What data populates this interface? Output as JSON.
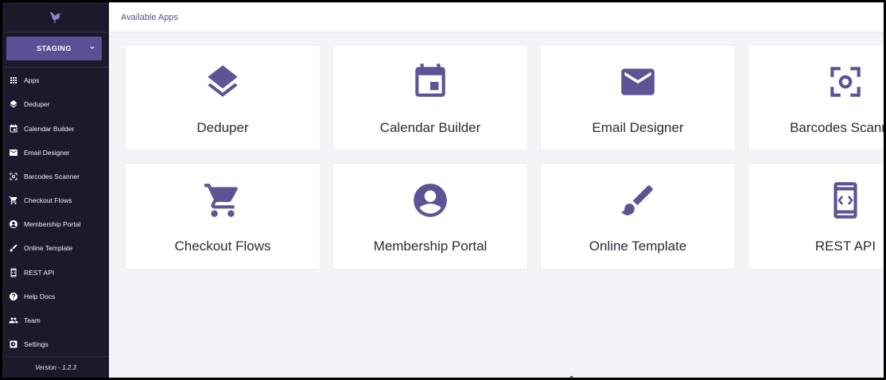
{
  "environment": {
    "label": "STAGING"
  },
  "sidebar": {
    "items": [
      {
        "label": "Apps",
        "icon": "apps-grid-icon"
      },
      {
        "label": "Deduper",
        "icon": "layers-icon"
      },
      {
        "label": "Calendar Builder",
        "icon": "calendar-icon"
      },
      {
        "label": "Email Designer",
        "icon": "mail-icon"
      },
      {
        "label": "Barcodes Scanner",
        "icon": "scanner-icon"
      },
      {
        "label": "Checkout Flows",
        "icon": "cart-icon"
      },
      {
        "label": "Membership Portal",
        "icon": "account-icon"
      },
      {
        "label": "Online Template",
        "icon": "brush-icon"
      },
      {
        "label": "REST API",
        "icon": "api-icon"
      },
      {
        "label": "Help Docs",
        "icon": "help-icon"
      },
      {
        "label": "Team",
        "icon": "team-icon"
      },
      {
        "label": "Settings",
        "icon": "settings-icon"
      }
    ],
    "version": "Version - 1.2.3"
  },
  "header": {
    "title": "Available Apps"
  },
  "apps": [
    {
      "title": "Deduper",
      "icon": "layers-icon"
    },
    {
      "title": "Calendar Builder",
      "icon": "calendar-icon"
    },
    {
      "title": "Email Designer",
      "icon": "mail-icon"
    },
    {
      "title": "Barcodes Scanner",
      "icon": "scanner-icon"
    },
    {
      "title": "Checkout Flows",
      "icon": "cart-icon"
    },
    {
      "title": "Membership Portal",
      "icon": "account-icon"
    },
    {
      "title": "Online Template",
      "icon": "brush-icon"
    },
    {
      "title": "REST API",
      "icon": "api-icon"
    }
  ],
  "colors": {
    "accent": "#5e5394",
    "sidebar_bg": "#1c1a2a",
    "env_button": "#5c4f96"
  }
}
